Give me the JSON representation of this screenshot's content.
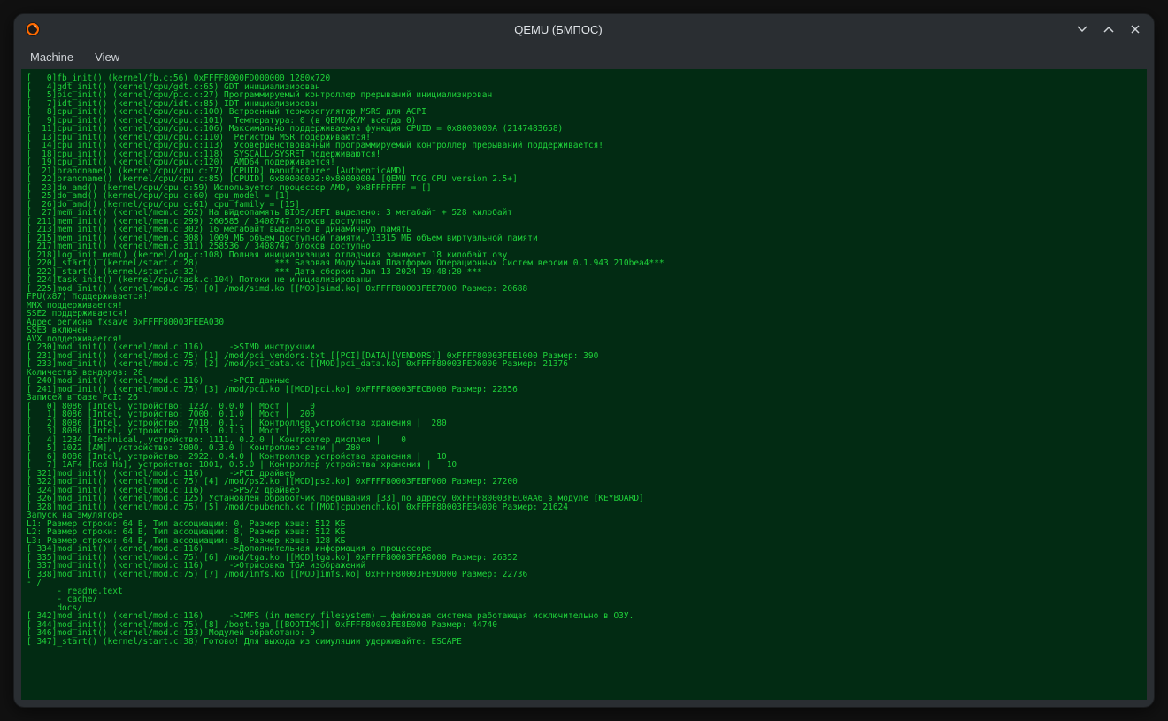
{
  "window": {
    "title": "QEMU (БМПОС)"
  },
  "menubar": {
    "machine": "Machine",
    "view": "View"
  },
  "terminal": {
    "lines": [
      "[   0]fb_init() (kernel/fb.c:56) 0xFFFF8000FD000000 1280x720",
      "[   4]gdt_init() (kernel/cpu/gdt.c:65) GDT инициализирован",
      "[   5]pic_init() (kernel/cpu/pic.c:27) Программируемый контроллер прерываний инициализирован",
      "[   7]idt_init() (kernel/cpu/idt.c:85) IDT инициализирован",
      "[   8]cpu_init() (kernel/cpu/cpu.c:100) Встроенный терморегулятор MSRS для ACPI",
      "[   9]cpu_init() (kernel/cpu/cpu.c:101)  Температура: 0 (в QEMU/KVM всегда 0)",
      "[  11]cpu_init() (kernel/cpu/cpu.c:106) Максимально поддерживаемая функция CPUID = 0x8000000A (2147483658)",
      "[  13]cpu_init() (kernel/cpu/cpu.c:110)  Регистры MSR подерживаются!",
      "[  14]cpu_init() (kernel/cpu/cpu.c:113)  Усовершенствованный программируемый контроллер прерываний поддерживается!",
      "[  18]cpu_init() (kernel/cpu/cpu.c:118)  SYSCALL/SYSRET подерживаются!",
      "[  19]cpu_init() (kernel/cpu/cpu.c:120)  AMD64 подерживается!",
      "[  21]brandname() (kernel/cpu/cpu.c:77) [CPUID] manufacturer [AuthenticAMD]",
      "[  22]brandname() (kernel/cpu/cpu.c:85) [CPUID] 0x80000002:0x80000004 [QEMU TCG CPU version 2.5+]",
      "[  23]do_amd() (kernel/cpu/cpu.c:59) Используется процессор AMD, 0x8FFFFFFF = []",
      "[  25]do_amd() (kernel/cpu/cpu.c:60) cpu_model = [1]",
      "[  26]do_amd() (kernel/cpu/cpu.c:61) cpu_family = [15]",
      "[  27]mem_init() (kernel/mem.c:262) На видеопамять BIOS/UEFI выделено: 3 мегабайт + 528 килобайт",
      "[ 211]mem_init() (kernel/mem.c:299) 260585 / 3408747 блоков доступно",
      "[ 213]mem_init() (kernel/mem.c:302) 16 мегабайт выделено в динамичную память",
      "[ 215]mem_init() (kernel/mem.c:308) 1009 МБ объем доступной памяти, 13315 МБ объем виртуальной памяти",
      "[ 217]mem_init() (kernel/mem.c:311) 258536 / 3408747 блоков доступно",
      "[ 218]log_init_mem() (kernel/log.c:108) Полная инициализация отладчика занимает 18 килобайт озу",
      "[ 220]_start() (kernel/start.c:28)               *** Базовая Модульная Платформа Операционных Систем версии 0.1.943 210bea4***",
      "[ 222]_start() (kernel/start.c:32)               *** Дата сборки: Jan 13 2024 19:48:20 ***",
      "[ 224]task_init() (kernel/cpu/task.c:104) Потоки не инициализированы",
      "[ 225]mod_init() (kernel/mod.c:75) [0] /mod/simd.ko [[MOD]simd.ko] 0xFFFF80003FEE7000 Размер: 20688",
      "FPU(x87) поддерживается!",
      "MMX поддерживается!",
      "SSE2 поддерживается!",
      "Адрес региона fxsave 0xFFFF80003FEEA030",
      "SSE3 включен",
      "AVX поддерживается!",
      "[ 230]mod_init() (kernel/mod.c:116)     ->SIMD инструкции",
      "[ 231]mod_init() (kernel/mod.c:75) [1] /mod/pci_vendors.txt [[PCI][DATA][VENDORS]] 0xFFFF80003FEE1000 Размер: 390",
      "[ 233]mod_init() (kernel/mod.c:75) [2] /mod/pci_data.ko [[MOD]pci_data.ko] 0xFFFF80003FED6000 Размер: 21376",
      "Количество вендоров: 26",
      "[ 240]mod_init() (kernel/mod.c:116)     ->PCI данные",
      "[ 241]mod_init() (kernel/mod.c:75) [3] /mod/pci.ko [[MOD]pci.ko] 0xFFFF80003FECB000 Размер: 22656",
      "Записей в базе PCI: 26",
      "[   0] 8086 [Intel, устройство: 1237, 0.0.0 | Мост |    0",
      "[   1] 8086 [Intel, устройство: 7000, 0.1.0 | Мост |  200",
      "[   2] 8086 [Intel, устройство: 7010, 0.1.1 | Контроллер устройства хранения |  280",
      "[   3] 8086 [Intel, устройство: 7113, 0.1.3 | Мост |  280",
      "[   4] 1234 [Technical, устройство: 1111, 0.2.0 | Контроллер дисплея |    0",
      "[   5] 1022 [AM], устройство: 2000, 0.3.0 | Контроллер сети |  280",
      "[   6] 8086 [Intel, устройство: 2922, 0.4.0 | Контроллер устройства хранения |   10",
      "[   7] 1AF4 [Red Ha], устройство: 1001, 0.5.0 | Контроллер устройства хранения |   10",
      "[ 321]mod_init() (kernel/mod.c:116)     ->PCI драйвер",
      "[ 322]mod_init() (kernel/mod.c:75) [4] /mod/ps2.ko [[MOD]ps2.ko] 0xFFFF80003FEBF000 Размер: 27200",
      "[ 324]mod_init() (kernel/mod.c:116)     ->PS/2 драйвер",
      "[ 326]mod_init() (kernel/mod.c:125) Установлен обработчик прерывания [33] по адресу 0xFFFF80003FEC0AA6 в модуле [KEYBOARD]",
      "[ 328]mod_init() (kernel/mod.c:75) [5] /mod/cpubench.ko [[MOD]cpubench.ko] 0xFFFF80003FEB4000 Размер: 21624",
      "Запуск на эмуляторе",
      "L1: Размер строки: 64 B, Тип ассоциации: 0, Размер кэша: 512 КБ",
      "L2: Размер строки: 64 B, Тип ассоциации: 8, Размер кэша: 512 КБ",
      "L3: Размер строки: 64 B, Тип ассоциации: 8, Размер кэша: 128 КБ",
      "[ 334]mod_init() (kernel/mod.c:116)     ->Дополнительная информация о процессоре",
      "[ 335]mod_init() (kernel/mod.c:75) [6] /mod/tga.ko [[MOD]tga.ko] 0xFFFF80003FEA8000 Размер: 26352",
      "[ 337]mod_init() (kernel/mod.c:116)     ->Отрисовка TGA изображений",
      "[ 338]mod_init() (kernel/mod.c:75) [7] /mod/imfs.ko [[MOD]imfs.ko] 0xFFFF80003FE9D000 Размер: 22736",
      "- /",
      "      - readme.text",
      "      - cache/",
      "      docs/",
      "[ 342]mod_init() (kernel/mod.c:116)     ->IMFS (in memory filesystem) — файловая система работающая исключительно в ОЗУ.",
      "[ 344]mod_init() (kernel/mod.c:75) [8] /boot.tga [[BOOTIMG]] 0xFFFF80003FE8E000 Размер: 44740",
      "[ 346]mod_init() (kernel/mod.c:133) Модулей обработано: 9",
      "[ 347]_start() (kernel/start.c:38) Готово! Для выхода из симуляции удерживайте: ESCAPE"
    ]
  }
}
